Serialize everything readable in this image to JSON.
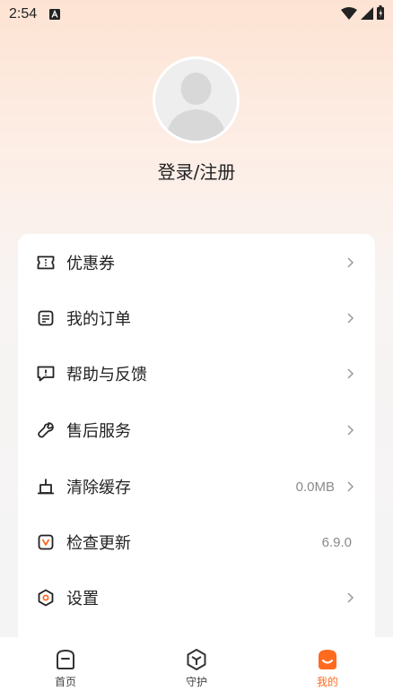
{
  "status_bar": {
    "time": "2:54"
  },
  "profile": {
    "login_label": "登录/注册"
  },
  "menu": {
    "items": [
      {
        "label": "优惠券",
        "value": "",
        "icon": "coupon-icon"
      },
      {
        "label": "我的订单",
        "value": "",
        "icon": "order-icon"
      },
      {
        "label": "帮助与反馈",
        "value": "",
        "icon": "feedback-icon"
      },
      {
        "label": "售后服务",
        "value": "",
        "icon": "after-sales-icon"
      },
      {
        "label": "清除缓存",
        "value": "0.0MB",
        "icon": "broom-icon"
      },
      {
        "label": "检查更新",
        "value": "6.9.0",
        "icon": "update-icon"
      },
      {
        "label": "设置",
        "value": "",
        "icon": "settings-icon"
      }
    ]
  },
  "bottom_nav": {
    "items": [
      {
        "label": "首页",
        "icon": "home-icon",
        "active": false
      },
      {
        "label": "守护",
        "icon": "guard-icon",
        "active": false
      },
      {
        "label": "我的",
        "icon": "profile-icon",
        "active": true
      }
    ]
  },
  "colors": {
    "accent": "#ff6a1f",
    "background_top": "#fde3d3"
  }
}
